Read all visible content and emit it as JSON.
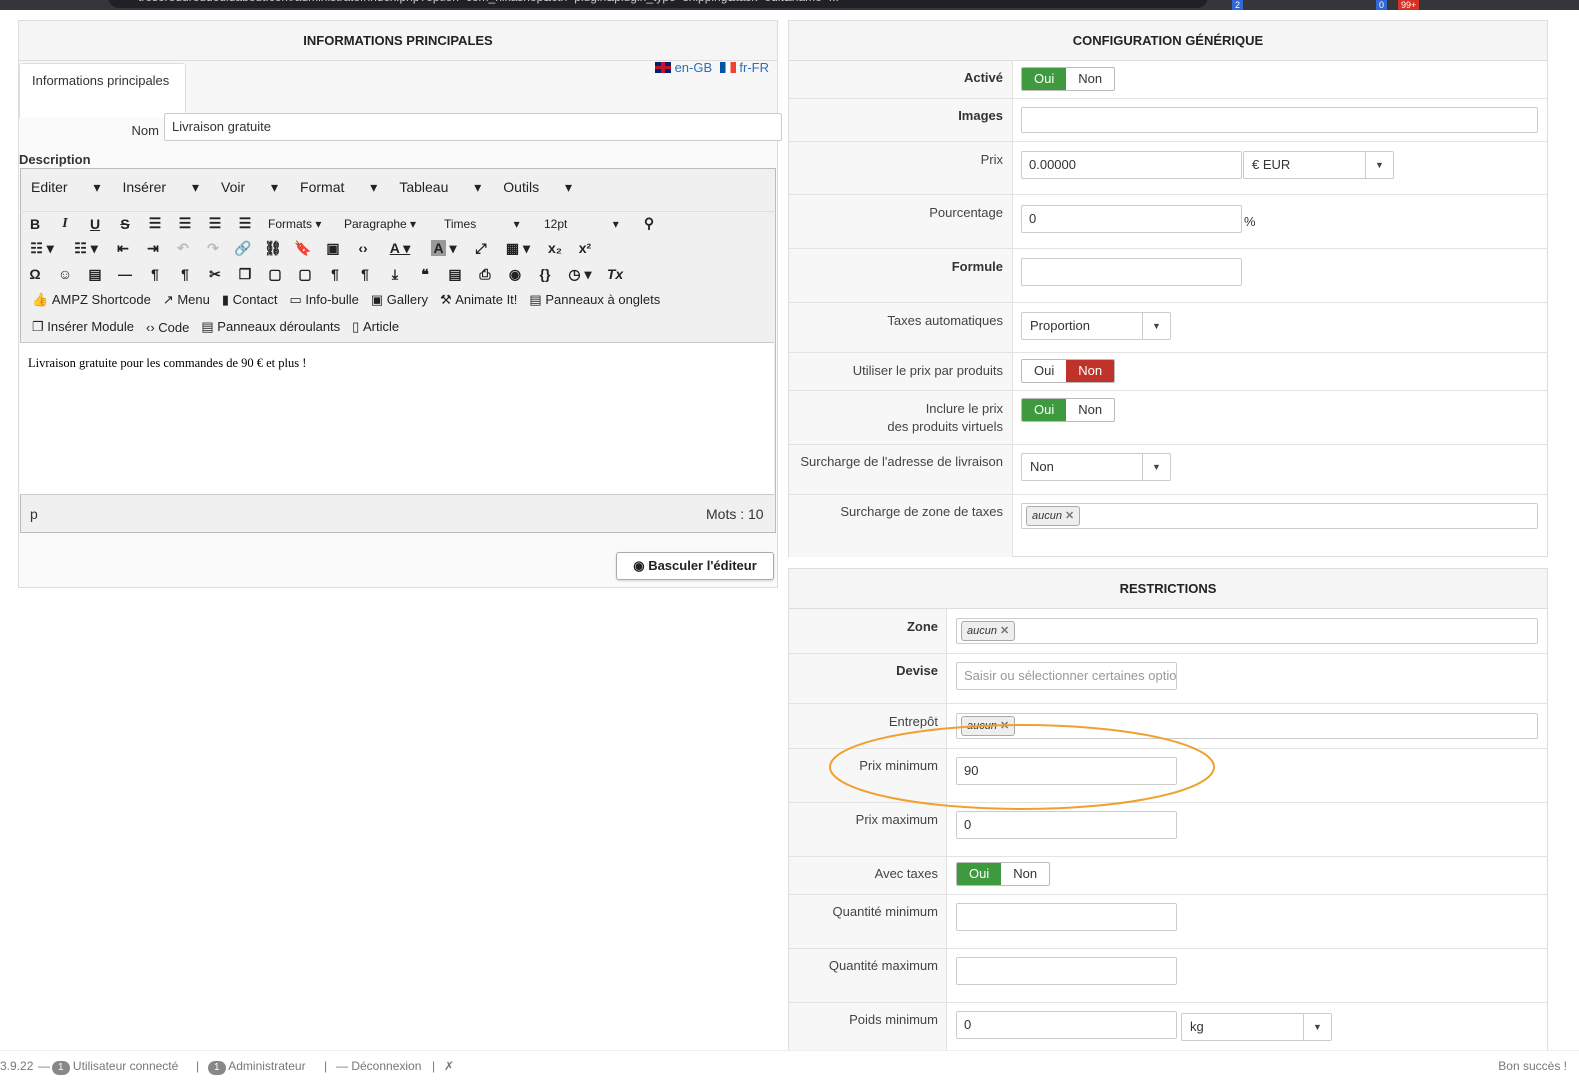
{
  "browser": {
    "url": "tresoreduroudouidabout.com/administrator/index.php?option=com_hikashop&ctrl=plugin&plugin_type=shipping&task=edit&name=...",
    "badges": [
      "2",
      "0",
      "99+"
    ]
  },
  "left": {
    "title": "INFORMATIONS PRINCIPALES",
    "tab": "Informations principales",
    "lang_en": "en-GB",
    "lang_fr": "fr-FR",
    "name_label": "Nom",
    "name_value": "Livraison gratuite",
    "desc_label": "Description",
    "menu": [
      "Editer",
      "Insérer",
      "Voir",
      "Format",
      "Tableau",
      "Outils"
    ],
    "fmt": {
      "formats": "Formats",
      "para": "Paragraphe",
      "font": "Times",
      "size": "12pt"
    },
    "plugins1": [
      "AMPZ Shortcode",
      "Menu",
      "Contact",
      "Info-bulle",
      "Gallery",
      "Animate It!",
      "Panneaux à onglets"
    ],
    "plugins2": [
      "Insérer Module",
      "Code",
      "Panneaux déroulants",
      "Article"
    ],
    "content": "Livraison gratuite pour les commandes de 90 € et plus !",
    "status_path": "p",
    "word_count": "Mots : 10",
    "toggle_editor": "Basculer l'éditeur"
  },
  "config": {
    "title": "CONFIGURATION GÉNÉRIQUE",
    "active_label": "Activé",
    "images_label": "Images",
    "price_label": "Prix",
    "price_value": "0.00000",
    "currency": "€ EUR",
    "percent_label": "Pourcentage",
    "percent_value": "0",
    "percent_sign": "%",
    "formula_label": "Formule",
    "auto_tax_label": "Taxes automatiques",
    "auto_tax_value": "Proportion",
    "per_product_label": "Utiliser le prix par produits",
    "virtual_label_1": "Inclure le prix",
    "virtual_label_2": "des produits virtuels",
    "address_override_label": "Surcharge de l'adresse de livraison",
    "address_override_value": "Non",
    "tax_zone_label": "Surcharge de zone de taxes",
    "yes": "Oui",
    "no": "Non",
    "none_tag": "aucun"
  },
  "restrictions": {
    "title": "RESTRICTIONS",
    "zone_label": "Zone",
    "currency_label": "Devise",
    "currency_placeholder": "Saisir ou sélectionner certaines options",
    "warehouse_label": "Entrepôt",
    "min_price_label": "Prix minimum",
    "min_price_value": "90",
    "max_price_label": "Prix maximum",
    "max_price_value": "0",
    "with_tax_label": "Avec taxes",
    "min_qty_label": "Quantité minimum",
    "max_qty_label": "Quantité maximum",
    "min_weight_label": "Poids minimum",
    "min_weight_value": "0",
    "weight_unit": "kg"
  },
  "footer": {
    "version": "3.9.22",
    "users_count": "1",
    "users_label": "Utilisateur connecté",
    "admin_count": "1",
    "admin_label": "Administrateur",
    "logout": "Déconnexion",
    "success": "Bon succès !"
  }
}
